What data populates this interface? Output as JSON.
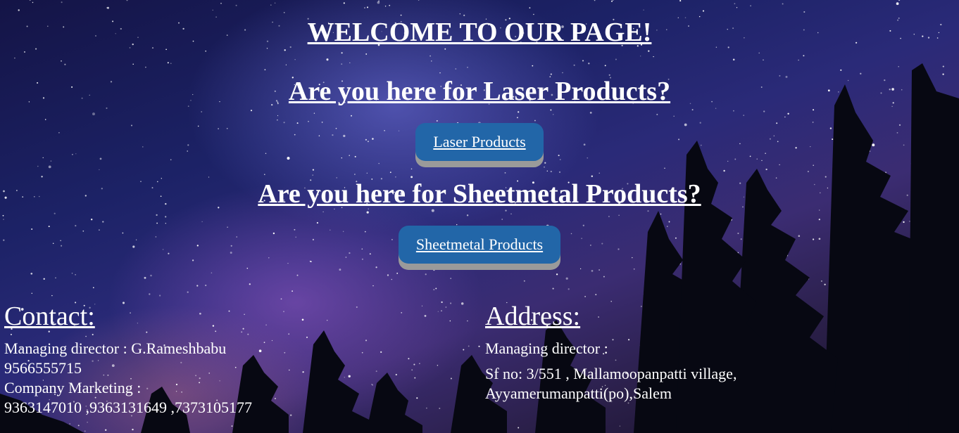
{
  "page": {
    "title": "WELCOME TO OUR PAGE!"
  },
  "laser": {
    "question": "Are you here for Laser Products?",
    "button_label": "Laser Products"
  },
  "sheetmetal": {
    "question": "Are you here for Sheetmetal Products?",
    "button_label": "Sheetmetal Products"
  },
  "contact": {
    "heading": "Contact:",
    "lines": [
      "Managing director : G.Rameshbabu",
      "9566555715",
      "Company Marketing :",
      "9363147010 ,9363131649 ,7373105177"
    ]
  },
  "address": {
    "heading": "Address:",
    "lines": [
      "Managing director :",
      "Sf no: 3/551 , Mallamoopanpatti village,",
      "Ayyamerumanpatti(po),Salem"
    ]
  },
  "colors": {
    "button_bg": "#2266a8",
    "button_shadow": "#9a9a9a",
    "text": "#ffffff"
  }
}
